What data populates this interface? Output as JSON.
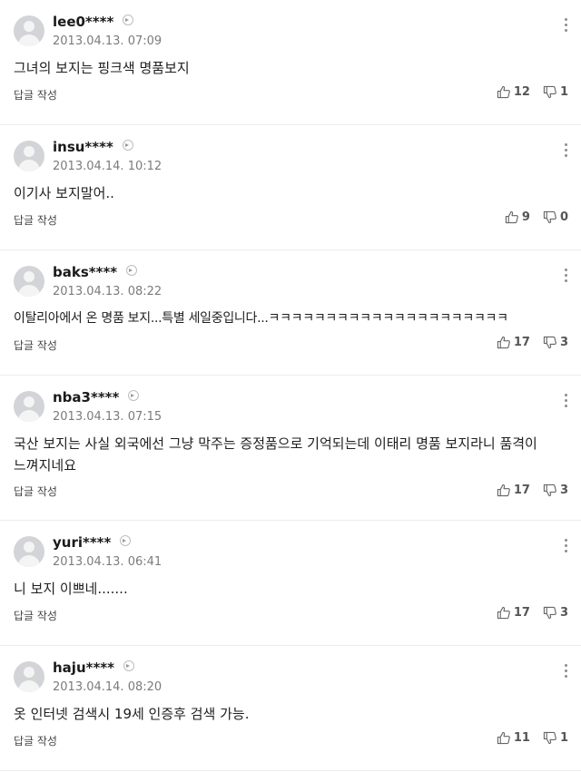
{
  "comments": [
    {
      "user": "lee0****",
      "date": "2013.04.13. 07:09",
      "text": "그녀의 보지는 핑크색 명품보지",
      "reply": "답글 작성",
      "likes": "12",
      "dislikes": "1"
    },
    {
      "user": "insu****",
      "date": "2013.04.14. 10:12",
      "text": "이기사 보지말어..",
      "reply": "답글 작성",
      "likes": "9",
      "dislikes": "0"
    },
    {
      "user": "baks****",
      "date": "2013.04.13. 08:22",
      "text": "이탈리아에서 온 명품 보지...특별 세일중입니다...ㅋㅋㅋㅋㅋㅋㅋㅋㅋㅋㅋㅋㅋㅋㅋㅋㅋㅋㅋㅋㅋ",
      "reply": "답글 작성",
      "likes": "17",
      "dislikes": "3"
    },
    {
      "user": "nba3****",
      "date": "2013.04.13. 07:15",
      "text": "국산 보지는 사실 외국에선 그냥 막주는 증정품으로 기억되는데 이태리 명품 보지라니 품격이 느껴지네요",
      "reply": "답글 작성",
      "likes": "17",
      "dislikes": "3"
    },
    {
      "user": "yuri****",
      "date": "2013.04.13. 06:41",
      "text": "니 보지 이쁘네.......",
      "reply": "답글 작성",
      "likes": "17",
      "dislikes": "3"
    },
    {
      "user": "haju****",
      "date": "2013.04.14. 08:20",
      "text": "옷 인터넷 검색시 19세 인증후 검색 가능.",
      "reply": "답글 작성",
      "likes": "11",
      "dislikes": "1"
    }
  ]
}
